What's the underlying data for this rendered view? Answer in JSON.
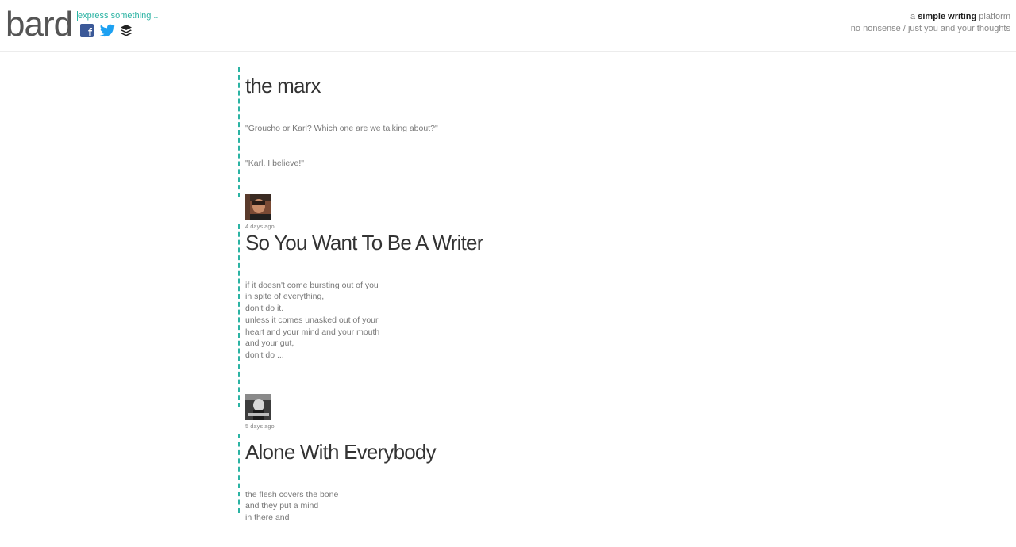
{
  "header": {
    "logo": "bard",
    "express_text": "express something ..",
    "social": [
      {
        "name": "facebook-icon",
        "color": "#3b5998"
      },
      {
        "name": "twitter-icon",
        "color": "#1da1f2"
      },
      {
        "name": "buffer-icon",
        "color": "#222222"
      }
    ],
    "tagline": {
      "prefix": "a ",
      "emphasis": "simple writing",
      "suffix": " platform",
      "second_line": "no nonsense / just you and your thoughts"
    }
  },
  "accent_color": "#2bb3a3",
  "posts": [
    {
      "title": "the marx",
      "paragraphs": [
        "\"Groucho or Karl? Which one are we talking about?\"",
        "\"Karl, I believe!\""
      ],
      "time": "4 days ago"
    },
    {
      "title": "So You Want To Be A Writer",
      "paragraphs": [
        "if it doesn't come bursting out of you\nin spite of everything,\ndon't do it.\nunless it comes unasked out of your\nheart and your mind and your mouth\nand your gut,\ndon't do ..."
      ],
      "time": "5 days ago"
    },
    {
      "title": "Alone With Everybody",
      "paragraphs": [
        "the flesh covers the bone\nand they put a mind\nin there and"
      ],
      "time": ""
    }
  ]
}
